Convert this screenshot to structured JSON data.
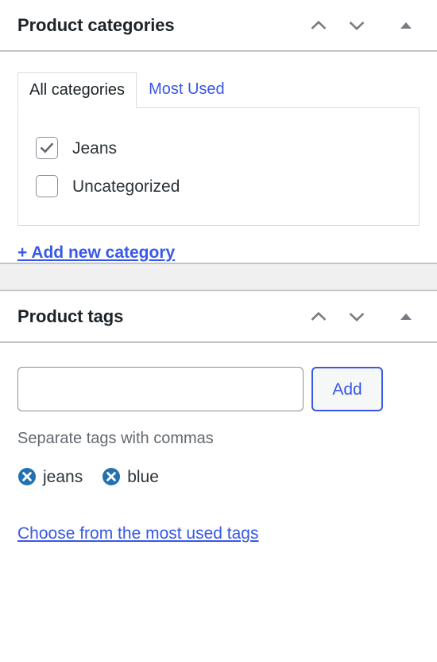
{
  "colors": {
    "link_blue": "#3858e9",
    "tag_remove_blue": "#2271b1",
    "heading": "#1d2327",
    "muted_text": "#646970",
    "border_gray": "#c3c4c7",
    "box_border": "#dcdcde",
    "gap_background": "#f0f0f1",
    "checkbox_border": "#8c8f94",
    "check_mark": "#646970"
  },
  "categories_panel": {
    "title": "Product categories",
    "actions": [
      {
        "name": "move-up",
        "icon": "chevron-up-icon"
      },
      {
        "name": "move-down",
        "icon": "chevron-down-icon"
      },
      {
        "name": "toggle-panel",
        "icon": "triangle-up-icon"
      }
    ],
    "tabs": [
      {
        "label": "All categories",
        "active": true
      },
      {
        "label": "Most Used",
        "active": false
      }
    ],
    "items": [
      {
        "label": "Jeans",
        "checked": true
      },
      {
        "label": "Uncategorized",
        "checked": false
      }
    ],
    "add_link": "+ Add new category"
  },
  "tags_panel": {
    "title": "Product tags",
    "actions": [
      {
        "name": "move-up",
        "icon": "chevron-up-icon"
      },
      {
        "name": "move-down",
        "icon": "chevron-down-icon"
      },
      {
        "name": "toggle-panel",
        "icon": "triangle-up-icon"
      }
    ],
    "input": {
      "value": "",
      "placeholder": ""
    },
    "add_button": "Add",
    "hint": "Separate tags with commas",
    "tags": [
      {
        "label": "jeans",
        "remove_icon": "remove-circle-icon"
      },
      {
        "label": "blue",
        "remove_icon": "remove-circle-icon"
      }
    ],
    "most_used_link": "Choose from the most used tags"
  }
}
